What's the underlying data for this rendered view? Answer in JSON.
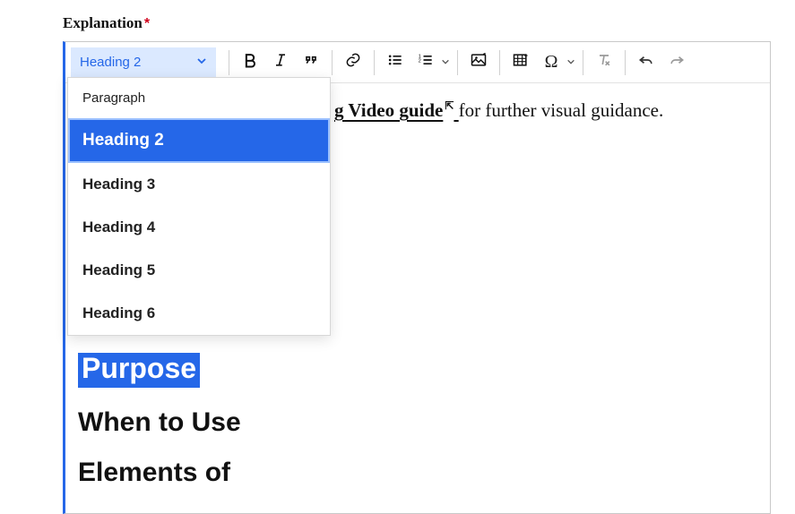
{
  "field": {
    "label": "Explanation",
    "required_mark": "*"
  },
  "toolbar": {
    "headings_label": "Heading 2"
  },
  "dropdown": {
    "items": [
      {
        "label": "Paragraph",
        "selected": false,
        "weight": "normal"
      },
      {
        "label": "Heading 2",
        "selected": true,
        "weight": "bold"
      },
      {
        "label": "Heading 3",
        "selected": false,
        "weight": "bold"
      },
      {
        "label": "Heading 4",
        "selected": false,
        "weight": "bold"
      },
      {
        "label": "Heading 5",
        "selected": false,
        "weight": "bold"
      },
      {
        "label": "Heading 6",
        "selected": false,
        "weight": "bold"
      }
    ]
  },
  "content": {
    "line1_link_fragment": "g Video guide",
    "line1_rest": " for further visual guidance.",
    "h_purpose": "Purpose",
    "h_whentouse": "When to Use",
    "h_elementsof": "Elements of"
  },
  "icons": {
    "bold": "bold-icon",
    "italic": "italic-icon",
    "quote": "quote-icon",
    "link": "link-icon",
    "bulleted": "bulleted-list-icon",
    "numbered": "numbered-list-icon",
    "media": "media-icon",
    "table": "table-icon",
    "omega": "special-char-icon",
    "clear": "clear-format-icon",
    "undo": "undo-icon",
    "redo": "redo-icon",
    "chevron": "chevron-down-icon",
    "external": "external-link-icon"
  }
}
